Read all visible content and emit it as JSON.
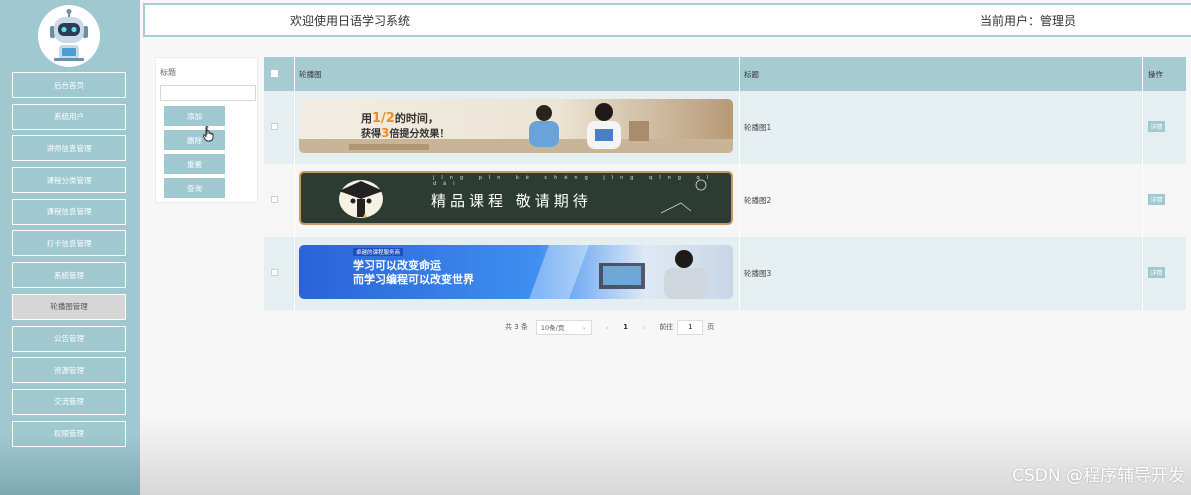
{
  "header": {
    "title": "欢迎使用日语学习系统",
    "user": "当前用户：管理员"
  },
  "sidebar": {
    "avatar_icon": "robot-avatar-icon",
    "items": [
      {
        "label": "后台首页"
      },
      {
        "label": "系统用户"
      },
      {
        "label": "讲师信息管理"
      },
      {
        "label": "课程分类管理"
      },
      {
        "label": "课程信息管理"
      },
      {
        "label": "打卡信息管理"
      },
      {
        "label": "系统管理"
      },
      {
        "label": "轮播图管理",
        "active": true
      },
      {
        "label": "公告管理"
      },
      {
        "label": "资源管理"
      },
      {
        "label": "交流管理"
      },
      {
        "label": "权限管理"
      }
    ]
  },
  "search": {
    "label": "标题",
    "placeholder": "",
    "buttons": {
      "add": "添加",
      "delete": "删除",
      "reset": "重置",
      "query": "查询"
    }
  },
  "table": {
    "headers": {
      "image": "轮播图",
      "title": "标题",
      "action": "操作"
    },
    "rows": [
      {
        "title": "轮播图1",
        "action": "详情",
        "banner_line1_prefix": "用",
        "banner_line1_highlight": "1/2",
        "banner_line1_suffix": "的时间，",
        "banner_line2_prefix": "获得",
        "banner_line2_highlight": "3",
        "banner_line2_suffix": "倍提分效果！"
      },
      {
        "title": "轮播图2",
        "action": "详情",
        "banner_pinyin": "jīng pǐn kè chéng jìng qǐng qī dài",
        "banner_text": "精品课程 敬请期待"
      },
      {
        "title": "轮播图3",
        "action": "详情",
        "banner_tag": "卓越的课程服务商",
        "banner_line1": "学习可以改变命运",
        "banner_line2": "而学习编程可以改变世界"
      }
    ]
  },
  "pager": {
    "total": "共 3 条",
    "page_size": "10条/页",
    "prev": "‹",
    "current": "1",
    "next": "›",
    "goto_label": "前往",
    "goto_value": "1",
    "page_suffix": "页"
  },
  "watermark": "CSDN @程序辅导开发",
  "colors": {
    "accent": "#9fc8d1",
    "header_row": "#a7cbd3",
    "odd_row": "#e5eff2",
    "highlight_orange": "#f28a1c"
  }
}
